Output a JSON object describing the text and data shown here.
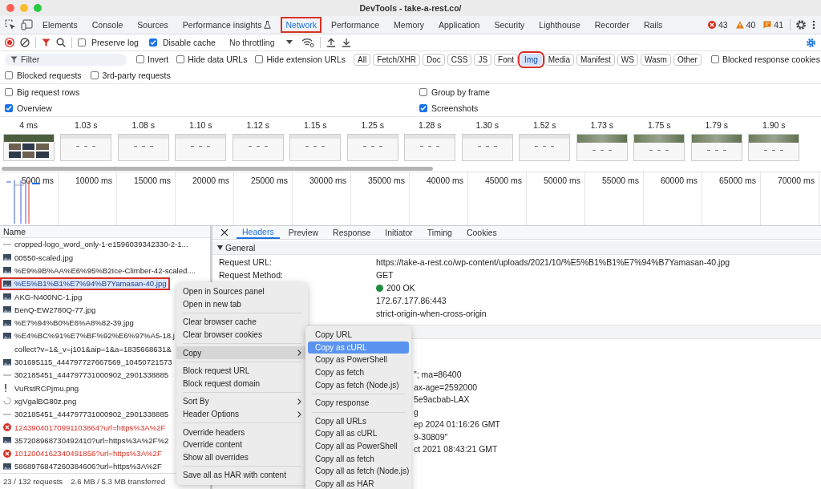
{
  "window": {
    "title": "DevTools - take-a-rest.co/"
  },
  "tabs": [
    {
      "label": "Elements",
      "selected": false,
      "highlighted": false,
      "experimental": false
    },
    {
      "label": "Console",
      "selected": false,
      "highlighted": false,
      "experimental": false
    },
    {
      "label": "Sources",
      "selected": false,
      "highlighted": false,
      "experimental": false
    },
    {
      "label": "Performance insights",
      "selected": false,
      "highlighted": false,
      "experimental": true
    },
    {
      "label": "Network",
      "selected": true,
      "highlighted": true,
      "experimental": false
    },
    {
      "label": "Performance",
      "selected": false,
      "highlighted": false,
      "experimental": false
    },
    {
      "label": "Memory",
      "selected": false,
      "highlighted": false,
      "experimental": false
    },
    {
      "label": "Application",
      "selected": false,
      "highlighted": false,
      "experimental": false
    },
    {
      "label": "Security",
      "selected": false,
      "highlighted": false,
      "experimental": false
    },
    {
      "label": "Lighthouse",
      "selected": false,
      "highlighted": false,
      "experimental": false
    },
    {
      "label": "Recorder",
      "selected": false,
      "highlighted": false,
      "experimental": false
    },
    {
      "label": "Rails",
      "selected": false,
      "highlighted": false,
      "experimental": false
    }
  ],
  "issues": [
    {
      "kind": "error",
      "count": "43"
    },
    {
      "kind": "warning",
      "count": "40"
    },
    {
      "kind": "info",
      "count": "41"
    }
  ],
  "toolbar": {
    "checkboxes": [
      {
        "label": "Preserve log",
        "checked": false
      },
      {
        "label": "Disable cache",
        "checked": true
      }
    ],
    "throttling": "No throttling"
  },
  "filter": {
    "placeholder": "Filter",
    "options": [
      {
        "label": "Invert",
        "checked": false
      },
      {
        "label": "Hide data URLs",
        "checked": false
      },
      {
        "label": "Hide extension URLs",
        "checked": false
      }
    ],
    "types": [
      {
        "label": "All",
        "selected": false,
        "highlighted": false
      },
      {
        "label": "Fetch/XHR",
        "selected": false,
        "highlighted": false
      },
      {
        "label": "Doc",
        "selected": false,
        "highlighted": false
      },
      {
        "label": "CSS",
        "selected": false,
        "highlighted": false
      },
      {
        "label": "JS",
        "selected": false,
        "highlighted": false
      },
      {
        "label": "Font",
        "selected": false,
        "highlighted": false
      },
      {
        "label": "Img",
        "selected": true,
        "highlighted": true
      },
      {
        "label": "Media",
        "selected": false,
        "highlighted": false
      },
      {
        "label": "Manifest",
        "selected": false,
        "highlighted": false
      },
      {
        "label": "WS",
        "selected": false,
        "highlighted": false
      },
      {
        "label": "Wasm",
        "selected": false,
        "highlighted": false
      },
      {
        "label": "Other",
        "selected": false,
        "highlighted": false
      }
    ],
    "trailing": [
      {
        "label": "Blocked response cookies",
        "checked": false
      }
    ],
    "more": [
      {
        "label": "Blocked requests",
        "checked": false
      },
      {
        "label": "3rd-party requests",
        "checked": false
      }
    ]
  },
  "settings": [
    {
      "label": "Big request rows",
      "checked": false
    },
    {
      "label": "Group by frame",
      "checked": false
    },
    {
      "label": "Overview",
      "checked": true
    },
    {
      "label": "Screenshots",
      "checked": true
    }
  ],
  "screenshots": [
    {
      "time": "4 ms",
      "kind": "page"
    },
    {
      "time": "1.03 s",
      "kind": "blank"
    },
    {
      "time": "1.08 s",
      "kind": "blank"
    },
    {
      "time": "1.10 s",
      "kind": "blank"
    },
    {
      "time": "1.12 s",
      "kind": "blank"
    },
    {
      "time": "1.15 s",
      "kind": "blank"
    },
    {
      "time": "1.25 s",
      "kind": "blank"
    },
    {
      "time": "1.28 s",
      "kind": "blank"
    },
    {
      "time": "1.30 s",
      "kind": "blank"
    },
    {
      "time": "1.52 s",
      "kind": "blank"
    },
    {
      "time": "1.73 s",
      "kind": "scenery"
    },
    {
      "time": "1.75 s",
      "kind": "scenery"
    },
    {
      "time": "1.79 s",
      "kind": "scenery"
    },
    {
      "time": "1.90 s",
      "kind": "scenery"
    }
  ],
  "overview": {
    "ticks": [
      "5000 ms",
      "10000 ms",
      "15000 ms",
      "20000 ms",
      "25000 ms",
      "30000 ms",
      "35000 ms",
      "40000 ms",
      "45000 ms",
      "50000 ms",
      "55000 ms",
      "60000 ms",
      "65000 ms",
      "70000 ms"
    ]
  },
  "requests": {
    "header": "Name",
    "rows": [
      {
        "name": "cropped-logo_word_only-1-e1596039342330-2-1...",
        "kind": "dash",
        "selected": false,
        "highlighted": false
      },
      {
        "name": "00550-scaled.jpg",
        "kind": "image",
        "selected": false,
        "highlighted": false
      },
      {
        "name": "%E9%9B%AA%E6%95%B2Ice-Climber-42-scaled....",
        "kind": "image",
        "selected": false,
        "highlighted": false
      },
      {
        "name": "%E5%B1%B1%E7%94%B7Yamasan-40.jpg",
        "kind": "image",
        "selected": true,
        "highlighted": true
      },
      {
        "name": "AKG-N400NC-1.jpg",
        "kind": "image",
        "selected": false,
        "highlighted": false
      },
      {
        "name": "BenQ-EW2780Q-77.jpg",
        "kind": "image",
        "selected": false,
        "highlighted": false
      },
      {
        "name": "%E7%94%B0%E6%A8%82-39.jpg",
        "kind": "image",
        "selected": false,
        "highlighted": false
      },
      {
        "name": "%E4%BC%91%E7%BF%92%E6%97%A5-18.j",
        "kind": "image",
        "selected": false,
        "highlighted": false
      },
      {
        "name": "collect?v=1&_v=j101&aip=1&a=1835668631&",
        "kind": "blank",
        "selected": false,
        "highlighted": false
      },
      {
        "name": "301695115_444797727667569_10450721573",
        "kind": "image",
        "selected": false,
        "highlighted": false
      },
      {
        "name": "302185451_444797731000902_2901338885",
        "kind": "dash",
        "selected": false,
        "highlighted": false
      },
      {
        "name": "VuRstRCPjmu.png",
        "kind": "script",
        "selected": false,
        "highlighted": false
      },
      {
        "name": "xgVgalBG80z.png",
        "kind": "spinner",
        "selected": false,
        "highlighted": false
      },
      {
        "name": "302185451_444797731000902_2901338885",
        "kind": "dash",
        "selected": false,
        "highlighted": false
      },
      {
        "name": "12439040170991103864?url=https%3A%2F",
        "kind": "error",
        "selected": false,
        "highlighted": false
      },
      {
        "name": "357208968730492410?url=https%3A%2F%2",
        "kind": "image",
        "selected": false,
        "highlighted": false
      },
      {
        "name": "1012004162340491856?url=https%3A%2F",
        "kind": "error",
        "selected": false,
        "highlighted": false
      },
      {
        "name": "5868976847260384606?url=https%3A%2F",
        "kind": "image",
        "selected": false,
        "highlighted": false
      }
    ],
    "status": [
      "23 / 132 requests",
      "2.6 MB / 5.3 MB transferred"
    ]
  },
  "details": {
    "tabs": [
      {
        "label": "Headers",
        "selected": true
      },
      {
        "label": "Preview",
        "selected": false
      },
      {
        "label": "Response",
        "selected": false
      },
      {
        "label": "Initiator",
        "selected": false
      },
      {
        "label": "Timing",
        "selected": false
      },
      {
        "label": "Cookies",
        "selected": false
      }
    ],
    "section": "General",
    "general": [
      {
        "label": "Request URL:",
        "value": "https://take-a-rest.co/wp-content/uploads/2021/10/%E5%B1%B1%E7%94%B7Yamasan-40.jpg",
        "kind": "text"
      },
      {
        "label": "Request Method:",
        "value": "GET",
        "kind": "text"
      },
      {
        "value": "200 OK",
        "kind": "status"
      },
      {
        "value": "172.67.177.86:443",
        "kind": "text"
      },
      {
        "value": "strict-origin-when-cross-origin",
        "kind": "text"
      }
    ],
    "fragments": [
      "\"; ma=86400",
      "ax-age=2592000",
      "5e9acbab-LAX",
      "g",
      "ep 2024 01:16:26 GMT",
      "9-30809\"",
      "ct 2021 08:43:21 GMT"
    ]
  },
  "context_menu": {
    "groups": [
      [
        {
          "label": "Open in Sources panel",
          "submenu": false,
          "selected": false
        },
        {
          "label": "Open in new tab",
          "submenu": false,
          "selected": false
        }
      ],
      [
        {
          "label": "Clear browser cache",
          "submenu": false,
          "selected": false
        },
        {
          "label": "Clear browser cookies",
          "submenu": false,
          "selected": false
        }
      ],
      [
        {
          "label": "Copy",
          "submenu": true,
          "selected": true
        }
      ],
      [
        {
          "label": "Block request URL",
          "submenu": false,
          "selected": false
        },
        {
          "label": "Block request domain",
          "submenu": false,
          "selected": false
        }
      ],
      [
        {
          "label": "Sort By",
          "submenu": true,
          "selected": false
        },
        {
          "label": "Header Options",
          "submenu": true,
          "selected": false
        }
      ],
      [
        {
          "label": "Override headers",
          "submenu": false,
          "selected": false
        },
        {
          "label": "Override content",
          "submenu": false,
          "selected": false
        },
        {
          "label": "Show all overrides",
          "submenu": false,
          "selected": false
        }
      ],
      [
        {
          "label": "Save all as HAR with content",
          "submenu": false,
          "selected": false
        }
      ]
    ]
  },
  "submenu": {
    "groups": [
      [
        {
          "label": "Copy URL",
          "selected": false
        },
        {
          "label": "Copy as cURL",
          "selected": true
        },
        {
          "label": "Copy as PowerShell",
          "selected": false
        },
        {
          "label": "Copy as fetch",
          "selected": false
        },
        {
          "label": "Copy as fetch (Node.js)",
          "selected": false
        }
      ],
      [
        {
          "label": "Copy response",
          "selected": false
        }
      ],
      [
        {
          "label": "Copy all URLs",
          "selected": false
        },
        {
          "label": "Copy all as cURL",
          "selected": false
        },
        {
          "label": "Copy all as PowerShell",
          "selected": false
        },
        {
          "label": "Copy all as fetch",
          "selected": false
        },
        {
          "label": "Copy all as fetch (Node.js)",
          "selected": false
        },
        {
          "label": "Copy all as HAR",
          "selected": false
        }
      ]
    ]
  }
}
